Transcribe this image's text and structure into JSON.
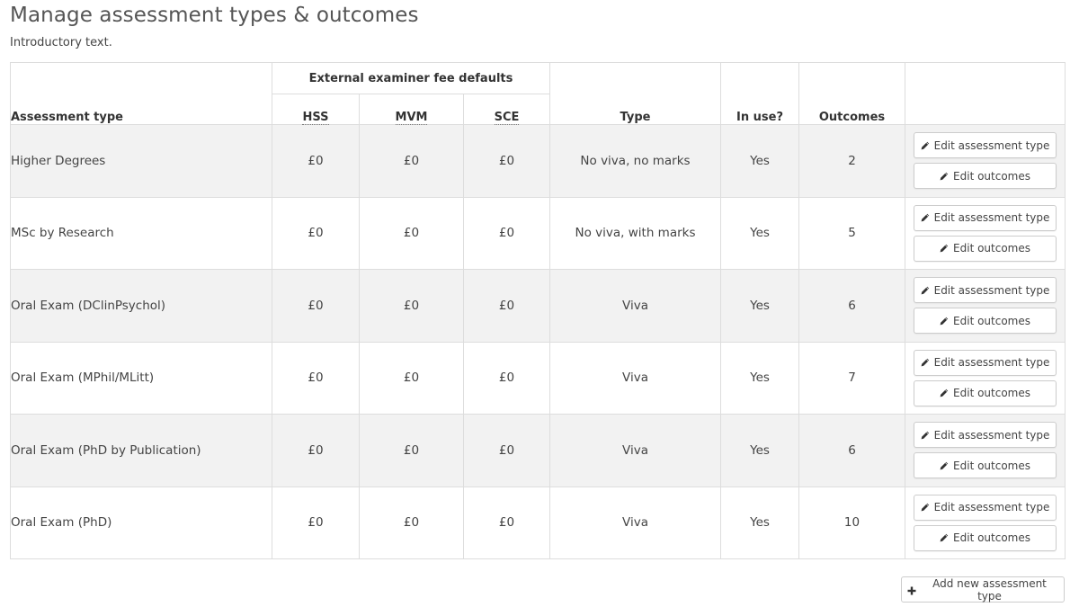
{
  "page": {
    "title": "Manage assessment types & outcomes",
    "intro": "Introductory text."
  },
  "table": {
    "headers": {
      "assessment_type": "Assessment type",
      "fee_group": "External examiner fee defaults",
      "fee_columns": [
        {
          "abbr": "HSS"
        },
        {
          "abbr": "MVM"
        },
        {
          "abbr": "SCE"
        }
      ],
      "type": "Type",
      "in_use": "In use?",
      "outcomes": "Outcomes"
    },
    "rows": [
      {
        "name": "Higher Degrees",
        "hss": "£0",
        "mvm": "£0",
        "sce": "£0",
        "type": "No viva, no marks",
        "in_use": "Yes",
        "outcomes": "2"
      },
      {
        "name": "MSc by Research",
        "hss": "£0",
        "mvm": "£0",
        "sce": "£0",
        "type": "No viva, with marks",
        "in_use": "Yes",
        "outcomes": "5"
      },
      {
        "name": "Oral Exam (DClinPsychol)",
        "hss": "£0",
        "mvm": "£0",
        "sce": "£0",
        "type": "Viva",
        "in_use": "Yes",
        "outcomes": "6"
      },
      {
        "name": "Oral Exam (MPhil/MLitt)",
        "hss": "£0",
        "mvm": "£0",
        "sce": "£0",
        "type": "Viva",
        "in_use": "Yes",
        "outcomes": "7"
      },
      {
        "name": "Oral Exam (PhD by Publication)",
        "hss": "£0",
        "mvm": "£0",
        "sce": "£0",
        "type": "Viva",
        "in_use": "Yes",
        "outcomes": "6"
      },
      {
        "name": "Oral Exam (PhD)",
        "hss": "£0",
        "mvm": "£0",
        "sce": "£0",
        "type": "Viva",
        "in_use": "Yes",
        "outcomes": "10"
      }
    ],
    "row_actions": {
      "edit_type_label": "Edit assessment type",
      "edit_type_icon": "pencil-icon",
      "edit_outcomes_label": "Edit outcomes",
      "edit_outcomes_icon": "pencil-icon"
    }
  },
  "footer": {
    "add_label": "Add new assessment type",
    "add_icon": "plus-icon"
  },
  "colors": {
    "border": "#dddddd",
    "stripe": "#f2f2f2",
    "text": "#333333",
    "button_border": "#cccccc"
  }
}
